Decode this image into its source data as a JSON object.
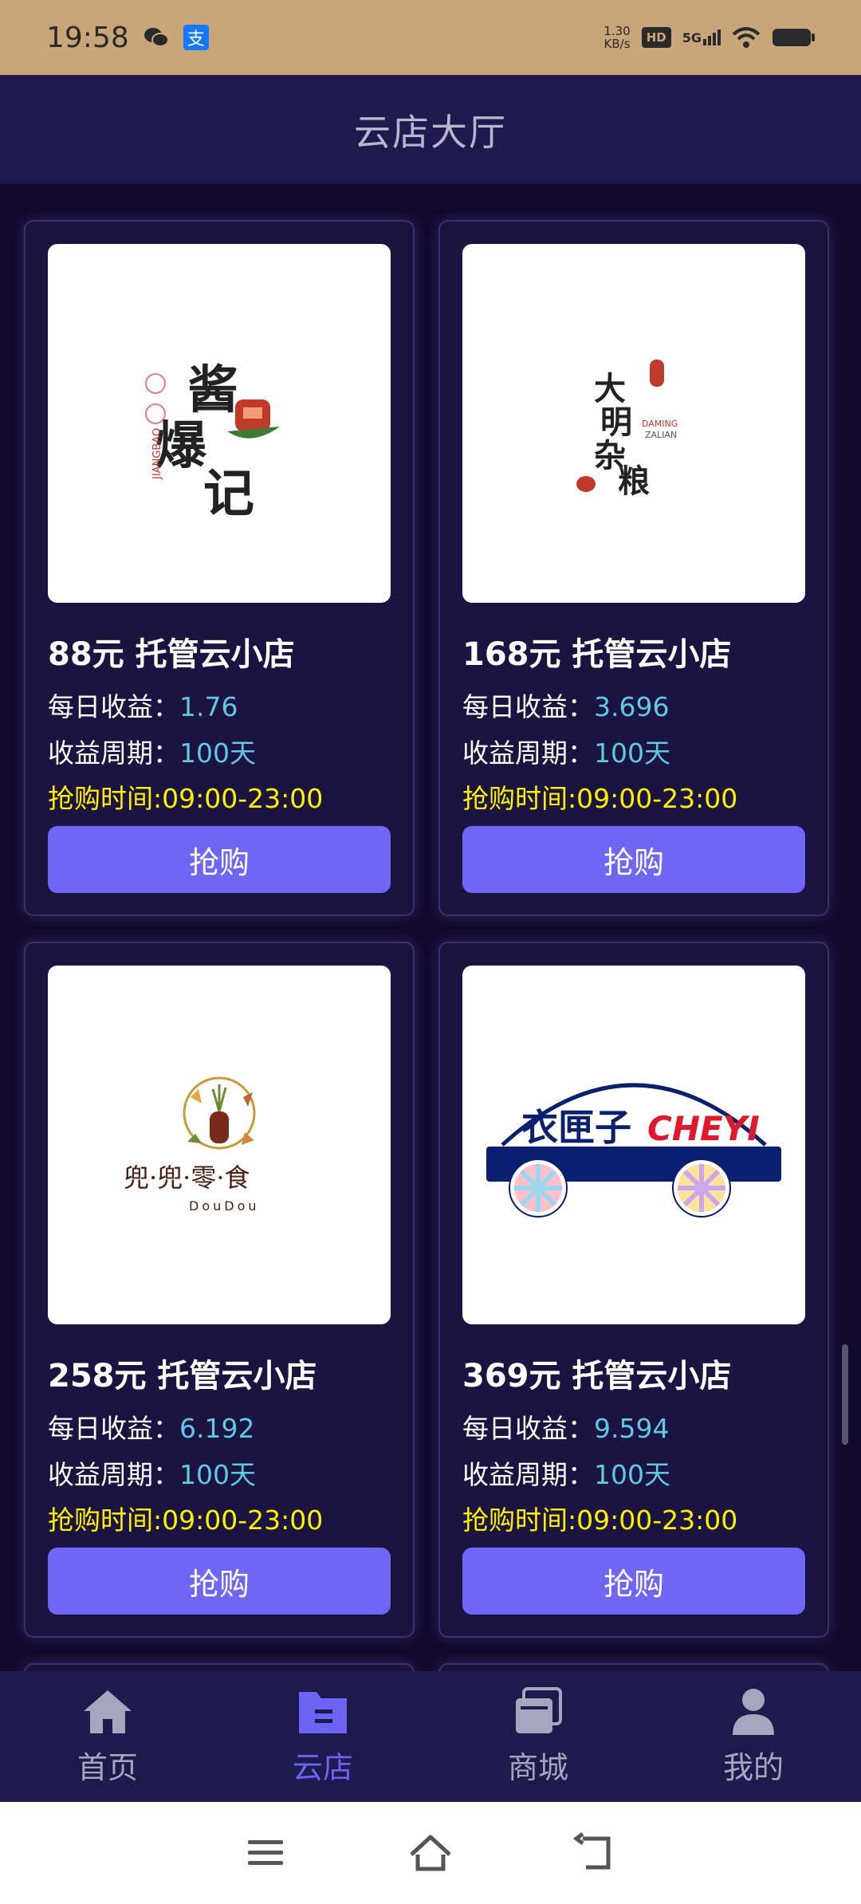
{
  "status_bar": {
    "time": "19:58",
    "alipay_glyph": "支",
    "speed_value": "1.30",
    "speed_unit": "KB/s",
    "hd": "HD",
    "network": "5G"
  },
  "header": {
    "title": "云店大厅"
  },
  "cards": [
    {
      "title": "88元 托管云小店",
      "daily_label": "每日收益：",
      "daily_value": "1.76",
      "period_label": "收益周期：",
      "period_value": "100天",
      "time_text": "抢购时间:09:00-23:00",
      "button": "抢购",
      "logo": {
        "main": "酱爆记",
        "sub": "JIANGBAO"
      }
    },
    {
      "title": "168元 托管云小店",
      "daily_label": "每日收益：",
      "daily_value": "3.696",
      "period_label": "收益周期：",
      "period_value": "100天",
      "time_text": "抢购时间:09:00-23:00",
      "button": "抢购",
      "logo": {
        "main": "大明杂粮",
        "sub": "DAMING ZALIAN"
      }
    },
    {
      "title": "258元 托管云小店",
      "daily_label": "每日收益：",
      "daily_value": "6.192",
      "period_label": "收益周期：",
      "period_value": "100天",
      "time_text": "抢购时间:09:00-23:00",
      "button": "抢购",
      "logo": {
        "main": "兜·兜·零·食",
        "sub": "DouDou"
      }
    },
    {
      "title": "369元 托管云小店",
      "daily_label": "每日收益：",
      "daily_value": "9.594",
      "period_label": "收益周期：",
      "period_value": "100天",
      "time_text": "抢购时间:09:00-23:00",
      "button": "抢购",
      "logo": {
        "main": "衣匣子",
        "sub": "CHEYI"
      }
    }
  ],
  "tabs": [
    {
      "label": "首页",
      "icon": "home-icon",
      "active": false
    },
    {
      "label": "云店",
      "icon": "folder-icon",
      "active": true
    },
    {
      "label": "商城",
      "icon": "store-icon",
      "active": false
    },
    {
      "label": "我的",
      "icon": "user-icon",
      "active": false
    }
  ],
  "colors": {
    "accent": "#6f66f6",
    "highlight": "#fff200",
    "value": "#5ec8e5",
    "background": "#120a2c"
  }
}
